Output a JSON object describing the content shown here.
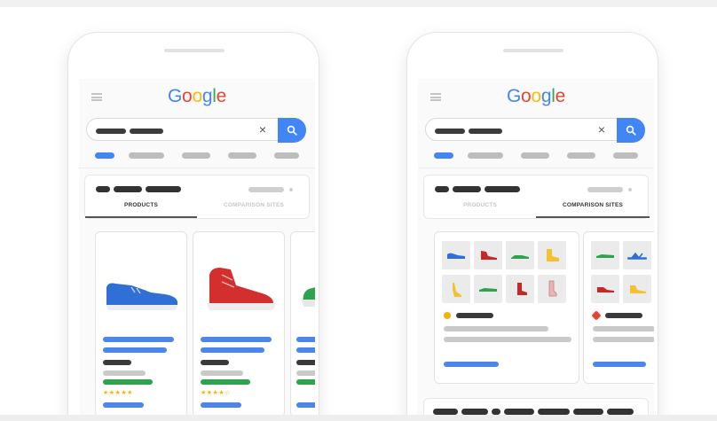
{
  "left_phone": {
    "logo": "Google",
    "clear_symbol": "×",
    "tabs": {
      "products": "PRODUCTS",
      "comparison_sites": "COMPARISON SITES"
    },
    "active_tab": "products",
    "products": [
      {
        "image": "blue-sneaker",
        "stars": "★★★★★"
      },
      {
        "image": "red-high-top-sneaker",
        "stars": "★★★★☆"
      },
      {
        "image": "partial-shoe"
      }
    ]
  },
  "right_phone": {
    "logo": "Google",
    "clear_symbol": "×",
    "tabs": {
      "products": "PRODUCTS",
      "comparison_sites": "COMPARISON SITES"
    },
    "active_tab": "comparison_sites",
    "comparison_thumbs": [
      "blue-sneaker",
      "red-sneaker",
      "green-sneaker",
      "yellow-boot",
      "yellow-heel",
      "green-flat",
      "red-boot",
      "pink-boot"
    ],
    "partial_thumbs": [
      "green-flat",
      "blue-sandal",
      "red-sneaker",
      "yellow-sneaker"
    ]
  },
  "colors": {
    "accent_blue": "#4285f4",
    "bar_blue": "#4b86e8",
    "rating_green": "#2ea24d",
    "star_yellow": "#f4b400"
  },
  "icons": [
    "menu-icon",
    "search-icon",
    "clear-icon",
    "star-rating-icon"
  ]
}
